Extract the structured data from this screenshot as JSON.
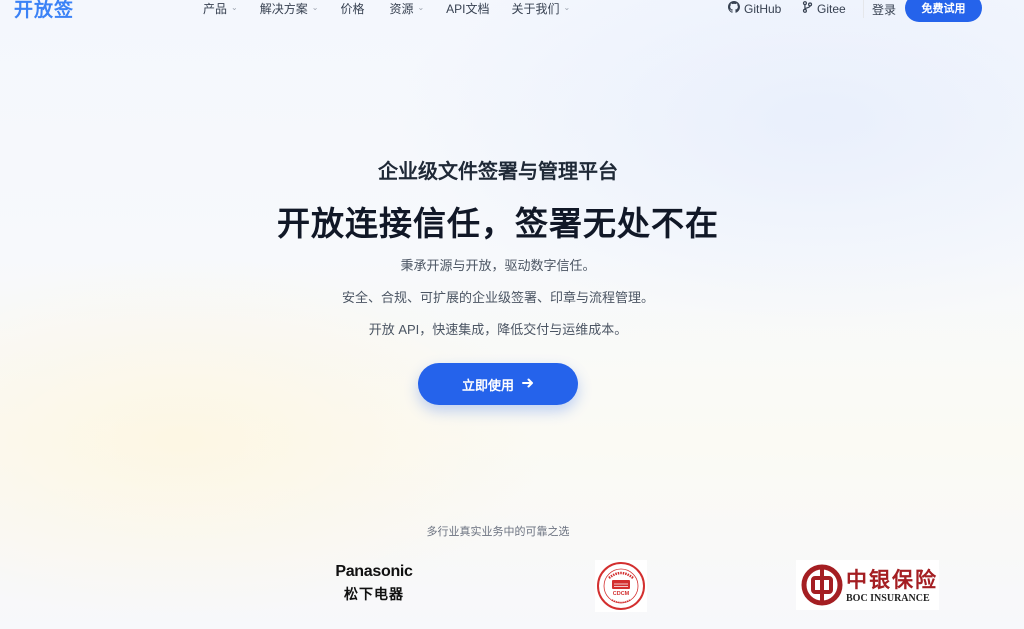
{
  "brand": {
    "logo_text": "开放签"
  },
  "nav": {
    "items": [
      {
        "label": "产品",
        "dropdown": true
      },
      {
        "label": "解决方案",
        "dropdown": true
      },
      {
        "label": "价格",
        "dropdown": false
      },
      {
        "label": "资源",
        "dropdown": true
      },
      {
        "label": "API文档",
        "dropdown": false
      },
      {
        "label": "关于我们",
        "dropdown": true
      }
    ],
    "github_label": "GitHub",
    "gitee_label": "Gitee",
    "login_label": "登录",
    "trial_label": "免费试用"
  },
  "hero": {
    "subtitle": "企业级文件签署与管理平台",
    "title": "开放连接信任，签署无处不在",
    "desc_1": "秉承开源与开放，驱动数字信任。",
    "desc_2": "安全、合规、可扩展的企业级签署、印章与流程管理。",
    "desc_3": "开放 API，快速集成，降低交付与运维成本。",
    "cta_label": "立即使用"
  },
  "customers": {
    "caption": "多行业真实业务中的可靠之选",
    "logos": [
      {
        "name": "panasonic-logo",
        "text_en": "Panasonic",
        "text_cn": "松下电器"
      },
      {
        "name": "cdcm-logo",
        "text_en": "CDCM"
      },
      {
        "name": "boc-insurance-logo",
        "text_cn": "中银保险",
        "text_en": "BOC INSURANCE"
      }
    ]
  },
  "colors": {
    "accent": "#2563eb",
    "logo": "#3b82f6",
    "boc_red": "#a41e22",
    "cdcm_red": "#d32f2f"
  },
  "icons": {
    "github": "github-icon",
    "gitee": "gitee-branch-icon",
    "dropdown": "chevron-down-icon",
    "cta": "arrow-right-icon"
  }
}
